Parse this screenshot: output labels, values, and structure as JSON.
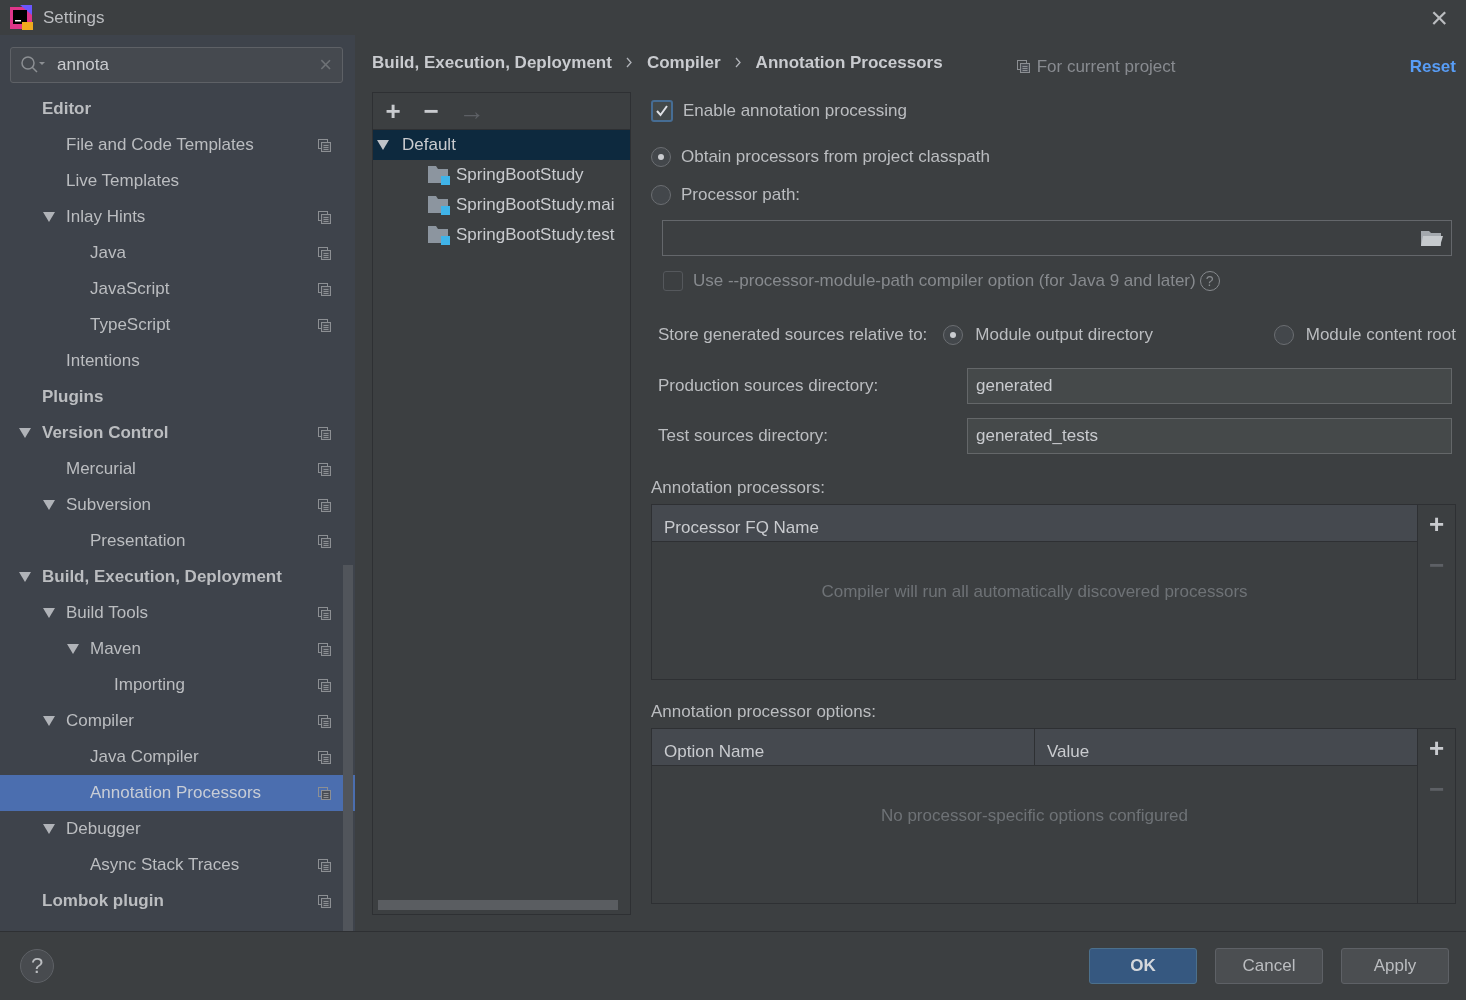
{
  "window": {
    "title": "Settings",
    "close": "×"
  },
  "search": {
    "value": "annota",
    "clear": "×"
  },
  "sidebar": {
    "items": [
      {
        "label": "Editor",
        "selected": false,
        "project_icon": false,
        "children": [
          {
            "label": "File and Code Templates",
            "selected": false,
            "project_icon": true
          },
          {
            "label": "Live Templates",
            "selected": false,
            "project_icon": false
          },
          {
            "label": "Inlay Hints",
            "expanded": true,
            "selected": false,
            "project_icon": true,
            "children": [
              {
                "label": "Java",
                "selected": false,
                "project_icon": true
              },
              {
                "label": "JavaScript",
                "selected": false,
                "project_icon": true
              },
              {
                "label": "TypeScript",
                "selected": false,
                "project_icon": true
              }
            ]
          },
          {
            "label": "Intentions",
            "selected": false,
            "project_icon": false
          }
        ]
      },
      {
        "label": "Plugins",
        "selected": false,
        "project_icon": false
      },
      {
        "label": "Version Control",
        "expanded": true,
        "selected": false,
        "project_icon": true,
        "children": [
          {
            "label": "Mercurial",
            "selected": false,
            "project_icon": true
          },
          {
            "label": "Subversion",
            "expanded": true,
            "selected": false,
            "project_icon": true,
            "children": [
              {
                "label": "Presentation",
                "selected": false,
                "project_icon": true
              }
            ]
          }
        ]
      },
      {
        "label": "Build, Execution, Deployment",
        "expanded": true,
        "selected": false,
        "project_icon": false,
        "children": [
          {
            "label": "Build Tools",
            "expanded": true,
            "selected": false,
            "project_icon": true,
            "children": [
              {
                "label": "Maven",
                "expanded": true,
                "selected": false,
                "project_icon": true,
                "children": [
                  {
                    "label": "Importing",
                    "selected": false,
                    "project_icon": true
                  }
                ]
              }
            ]
          },
          {
            "label": "Compiler",
            "expanded": true,
            "selected": false,
            "project_icon": true,
            "children": [
              {
                "label": "Java Compiler",
                "selected": false,
                "project_icon": true
              },
              {
                "label": "Annotation Processors",
                "selected": true,
                "project_icon": true
              }
            ]
          },
          {
            "label": "Debugger",
            "expanded": true,
            "selected": false,
            "project_icon": false,
            "children": [
              {
                "label": "Async Stack Traces",
                "selected": false,
                "project_icon": true
              }
            ]
          }
        ]
      },
      {
        "label": "Lombok plugin",
        "selected": false,
        "project_icon": true
      }
    ]
  },
  "breadcrumb": [
    "Build, Execution, Deployment",
    "Compiler",
    "Annotation Processors"
  ],
  "scope": "For current project",
  "reset": "Reset",
  "profiles": {
    "toolbar": [
      {
        "symbol": "+",
        "disabled": false
      },
      {
        "symbol": "−",
        "disabled": false
      },
      {
        "symbol": "→",
        "disabled": true
      }
    ],
    "tree": [
      {
        "label": "Default",
        "expanded": true,
        "selected": true,
        "children": [
          {
            "label": "SpringBootStudy",
            "selected": false
          },
          {
            "label": "SpringBootStudy.mai",
            "selected": false
          },
          {
            "label": "SpringBootStudy.test",
            "selected": false
          }
        ]
      }
    ]
  },
  "enable_processing": {
    "label": "Enable annotation processing",
    "checked": true
  },
  "source_options": [
    {
      "label": "Obtain processors from project classpath",
      "selected": true
    },
    {
      "label": "Processor path:",
      "selected": false
    }
  ],
  "processor_path": {
    "browse": true
  },
  "module_path_option": {
    "label": "Use --processor-module-path compiler option (for Java 9 and later)",
    "checked": false,
    "disabled": true,
    "help": "?"
  },
  "store_relative": {
    "label": "Store generated sources relative to:",
    "options": [
      {
        "label": "Module output directory",
        "selected": true
      },
      {
        "label": "Module content root",
        "selected": false
      }
    ]
  },
  "directories": [
    {
      "label": "Production sources directory:",
      "value": "generated"
    },
    {
      "label": "Test sources directory:",
      "value": "generated_tests"
    }
  ],
  "tables": [
    {
      "title": "Annotation processors:",
      "columns": [
        "Processor FQ Name"
      ],
      "empty_text": "Compiler will run all automatically discovered processors",
      "add": "+",
      "remove": "−"
    },
    {
      "title": "Annotation processor options:",
      "columns": [
        "Option Name",
        "Value"
      ],
      "empty_text": "No processor-specific options configured",
      "add": "+",
      "remove": "−"
    }
  ],
  "footer": {
    "help": "?",
    "buttons": [
      {
        "label": "OK",
        "kind": "primary"
      },
      {
        "label": "Cancel",
        "kind": "default"
      },
      {
        "label": "Apply",
        "kind": "default"
      }
    ]
  }
}
